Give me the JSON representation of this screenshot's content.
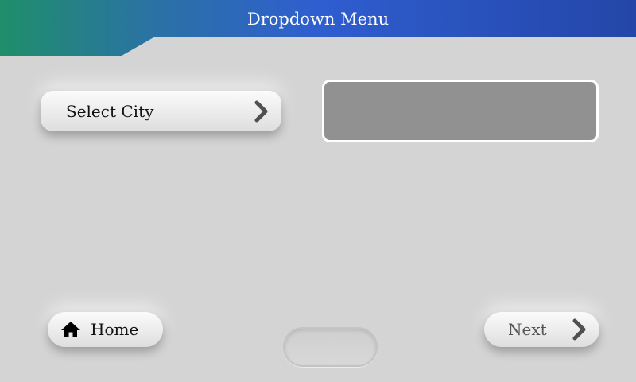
{
  "header": {
    "title": "Dropdown Menu"
  },
  "select": {
    "label": "Select City",
    "icon": "chevron-right-icon"
  },
  "display": {
    "value": ""
  },
  "nav": {
    "home_label": "Home",
    "home_icon": "home-icon",
    "next_label": "Next",
    "next_icon": "chevron-right-icon"
  },
  "colors": {
    "header_start": "#1f8f6a",
    "header_end": "#2f5ed0",
    "background": "#d4d4d4",
    "display_fill": "#919191"
  }
}
